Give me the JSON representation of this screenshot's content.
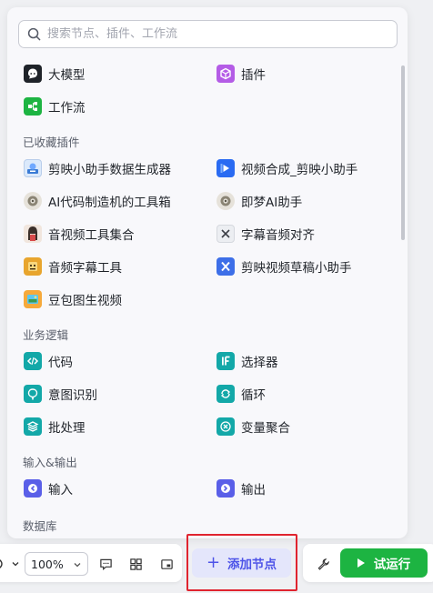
{
  "search": {
    "placeholder": "搜索节点、插件、工作流"
  },
  "top_items": [
    {
      "label": "大模型",
      "icon": "llm-icon",
      "color": "#1f2329"
    },
    {
      "label": "插件",
      "icon": "plugin-icon",
      "color": "#b45ce6"
    },
    {
      "label": "工作流",
      "icon": "workflow-icon",
      "color": "#1db442"
    }
  ],
  "favorites": {
    "title": "已收藏插件",
    "items": [
      {
        "label": "剪映小助手数据生成器",
        "icon": "capcut-data-icon"
      },
      {
        "label": "视频合成_剪映小助手",
        "icon": "video-compose-icon"
      },
      {
        "label": "AI代码制造机的工具箱",
        "icon": "ai-code-toolbox-icon"
      },
      {
        "label": "即梦AI助手",
        "icon": "jimeng-icon"
      },
      {
        "label": "音视频工具集合",
        "icon": "av-tools-icon"
      },
      {
        "label": "字幕音频对齐",
        "icon": "subtitle-align-icon"
      },
      {
        "label": "音频字幕工具",
        "icon": "audio-subtitle-icon"
      },
      {
        "label": "剪映视频草稿小助手",
        "icon": "capcut-draft-icon"
      },
      {
        "label": "豆包图生视频",
        "icon": "doubao-video-icon"
      }
    ]
  },
  "logic": {
    "title": "业务逻辑",
    "items": [
      {
        "label": "代码",
        "icon": "code-icon"
      },
      {
        "label": "选择器",
        "icon": "if-selector-icon"
      },
      {
        "label": "意图识别",
        "icon": "intent-icon"
      },
      {
        "label": "循环",
        "icon": "loop-icon"
      },
      {
        "label": "批处理",
        "icon": "batch-icon"
      },
      {
        "label": "变量聚合",
        "icon": "variable-merge-icon"
      }
    ]
  },
  "io": {
    "title": "输入&输出",
    "items": [
      {
        "label": "输入",
        "icon": "input-icon"
      },
      {
        "label": "输出",
        "icon": "output-icon"
      }
    ]
  },
  "database": {
    "title": "数据库"
  },
  "toolbar": {
    "zoom": "100%",
    "add_node": "添加节点",
    "run": "试运行"
  },
  "colors": {
    "teal": "#13a8a8",
    "purple": "#5a5fe8",
    "green": "#1db442",
    "accent": "#4d53e8",
    "highlight": "#e0242f"
  }
}
